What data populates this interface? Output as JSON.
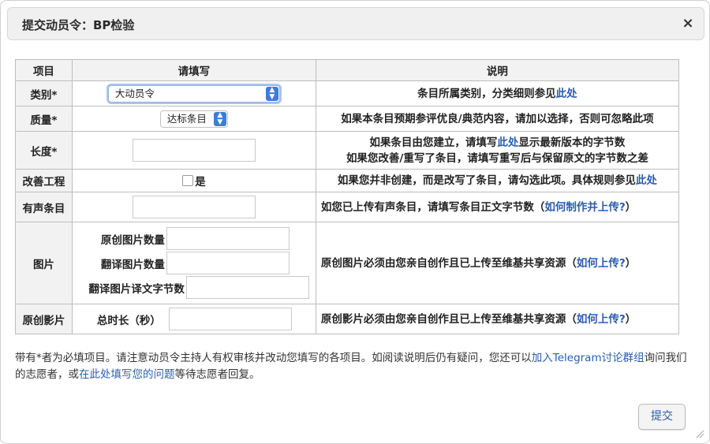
{
  "dialog": {
    "title": "提交动员令：BP检验",
    "close_label": "×"
  },
  "table": {
    "headers": [
      "项目",
      "请填写",
      "说明"
    ],
    "category": {
      "label": "类别*",
      "selected": "大动员令",
      "desc_text": "条目所属类别，分类细则参见",
      "desc_link": "此处"
    },
    "quality": {
      "label": "质量*",
      "selected": "达标条目",
      "desc": "如果本条目预期参评优良/典范内容，请加以选择，否则可忽略此项"
    },
    "length": {
      "label": "长度*",
      "value": "",
      "desc1_a": "如果条目由您建立，请填写",
      "desc1_link": "此处",
      "desc1_b": "显示最新版本的字节数",
      "desc2": "如果您改善/重写了条目，请填写重写后与保留原文的字节数之差"
    },
    "improve": {
      "label": "改善工程",
      "checkbox_label": "是",
      "checked": false,
      "desc_text": "如果您并非创建，而是改写了条目，请勾选此项。具体规则参见",
      "desc_link": "此处"
    },
    "audio": {
      "label": "有声条目",
      "value": "",
      "desc_text": "如您已上传有声条目，请填写条目正文字节数（",
      "desc_link": "如何制作并上传?",
      "desc_end": "）"
    },
    "images": {
      "label": "图片",
      "sub": [
        "原创图片数量",
        "翻译图片数量",
        "翻译图片译文字节数"
      ],
      "desc_text": "原创图片必须由您亲自创作且已上传至维基共享资源（",
      "desc_link": "如何上传?",
      "desc_end": "）"
    },
    "video": {
      "label": "原创影片",
      "sub": "总时长（秒）",
      "desc_text": "原创影片必须由您亲自创作且已上传至维基共享资源（",
      "desc_link": "如何上传?",
      "desc_end": "）"
    }
  },
  "footer": {
    "text1": "带有*者为必填项目。请注意动员令主持人有权审核并改动您填写的各项目。如阅读说明后仍有疑问，您还可以",
    "link1": "加入Telegram讨论群组",
    "text2": "询问我们的志愿者，或",
    "link2": "在此处填写您的问题",
    "text3": "等待志愿者回复。"
  },
  "submit_label": "提交",
  "colors": {
    "link": "#2a5db0",
    "header_bg": "#f2f2f2",
    "select_accent": "#3b7ddb"
  }
}
